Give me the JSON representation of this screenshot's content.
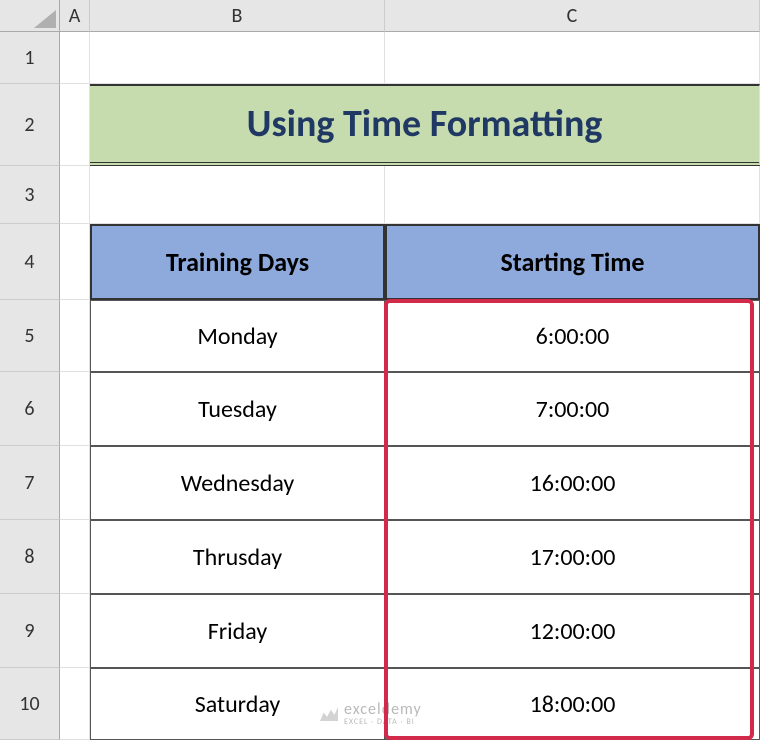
{
  "columns": [
    "A",
    "B",
    "C"
  ],
  "rows": [
    "1",
    "2",
    "3",
    "4",
    "5",
    "6",
    "7",
    "8",
    "9",
    "10"
  ],
  "title": "Using Time Formatting",
  "table": {
    "headers": {
      "days": "Training Days",
      "time": "Starting Time"
    },
    "rows": [
      {
        "day": "Monday",
        "time": "6:00:00"
      },
      {
        "day": "Tuesday",
        "time": "7:00:00"
      },
      {
        "day": "Wednesday",
        "time": "16:00:00"
      },
      {
        "day": "Thrusday",
        "time": "17:00:00"
      },
      {
        "day": "Friday",
        "time": "12:00:00"
      },
      {
        "day": "Saturday",
        "time": "18:00:00"
      }
    ]
  },
  "watermark": {
    "name": "exceldemy",
    "tag": "EXCEL · DATA · BI"
  }
}
